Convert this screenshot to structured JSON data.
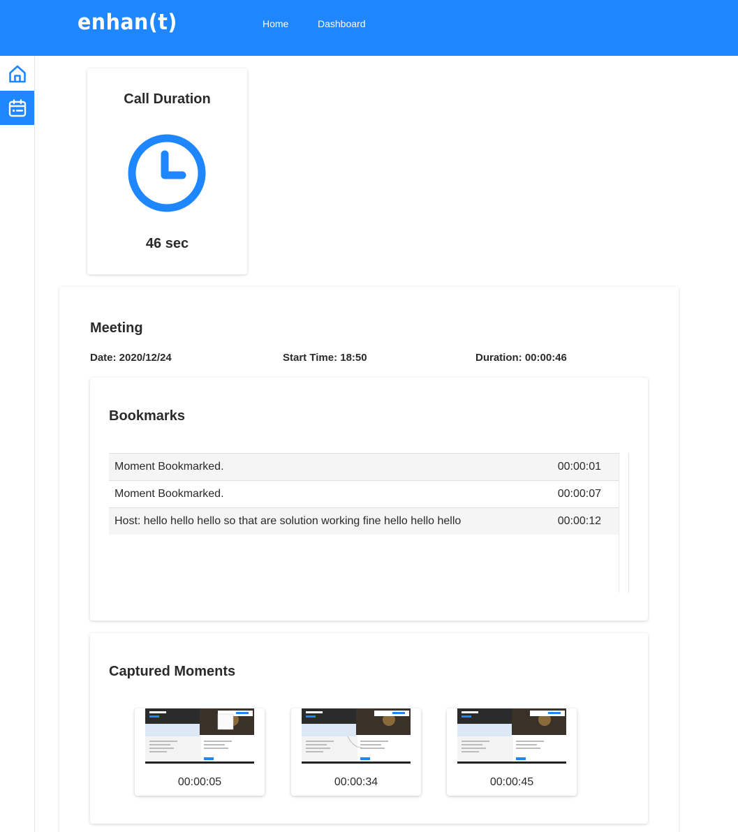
{
  "app": {
    "logo": "enhan(t)",
    "brand_color": "#1e86ff"
  },
  "nav": {
    "home": "Home",
    "dashboard": "Dashboard"
  },
  "sidebar": {
    "items": [
      {
        "icon": "home-icon",
        "active": false
      },
      {
        "icon": "calendar-icon",
        "active": true
      }
    ]
  },
  "call_duration": {
    "title": "Call Duration",
    "icon": "clock-icon",
    "value": "46 sec"
  },
  "meeting": {
    "title": "Meeting",
    "date": "Date: 2020/12/24",
    "start_time": "Start Time: 18:50",
    "duration": "Duration: 00:00:46"
  },
  "bookmarks": {
    "title": "Bookmarks",
    "rows": [
      {
        "text": "Moment Bookmarked.",
        "time": "00:00:01"
      },
      {
        "text": "Moment Bookmarked.",
        "time": "00:00:07"
      },
      {
        "text": "Host: hello hello hello so that are solution working fine hello hello hello",
        "time": "00:00:12"
      }
    ]
  },
  "captured_moments": {
    "title": "Captured Moments",
    "items": [
      {
        "time": "00:00:05"
      },
      {
        "time": "00:00:34"
      },
      {
        "time": "00:00:45"
      }
    ]
  }
}
